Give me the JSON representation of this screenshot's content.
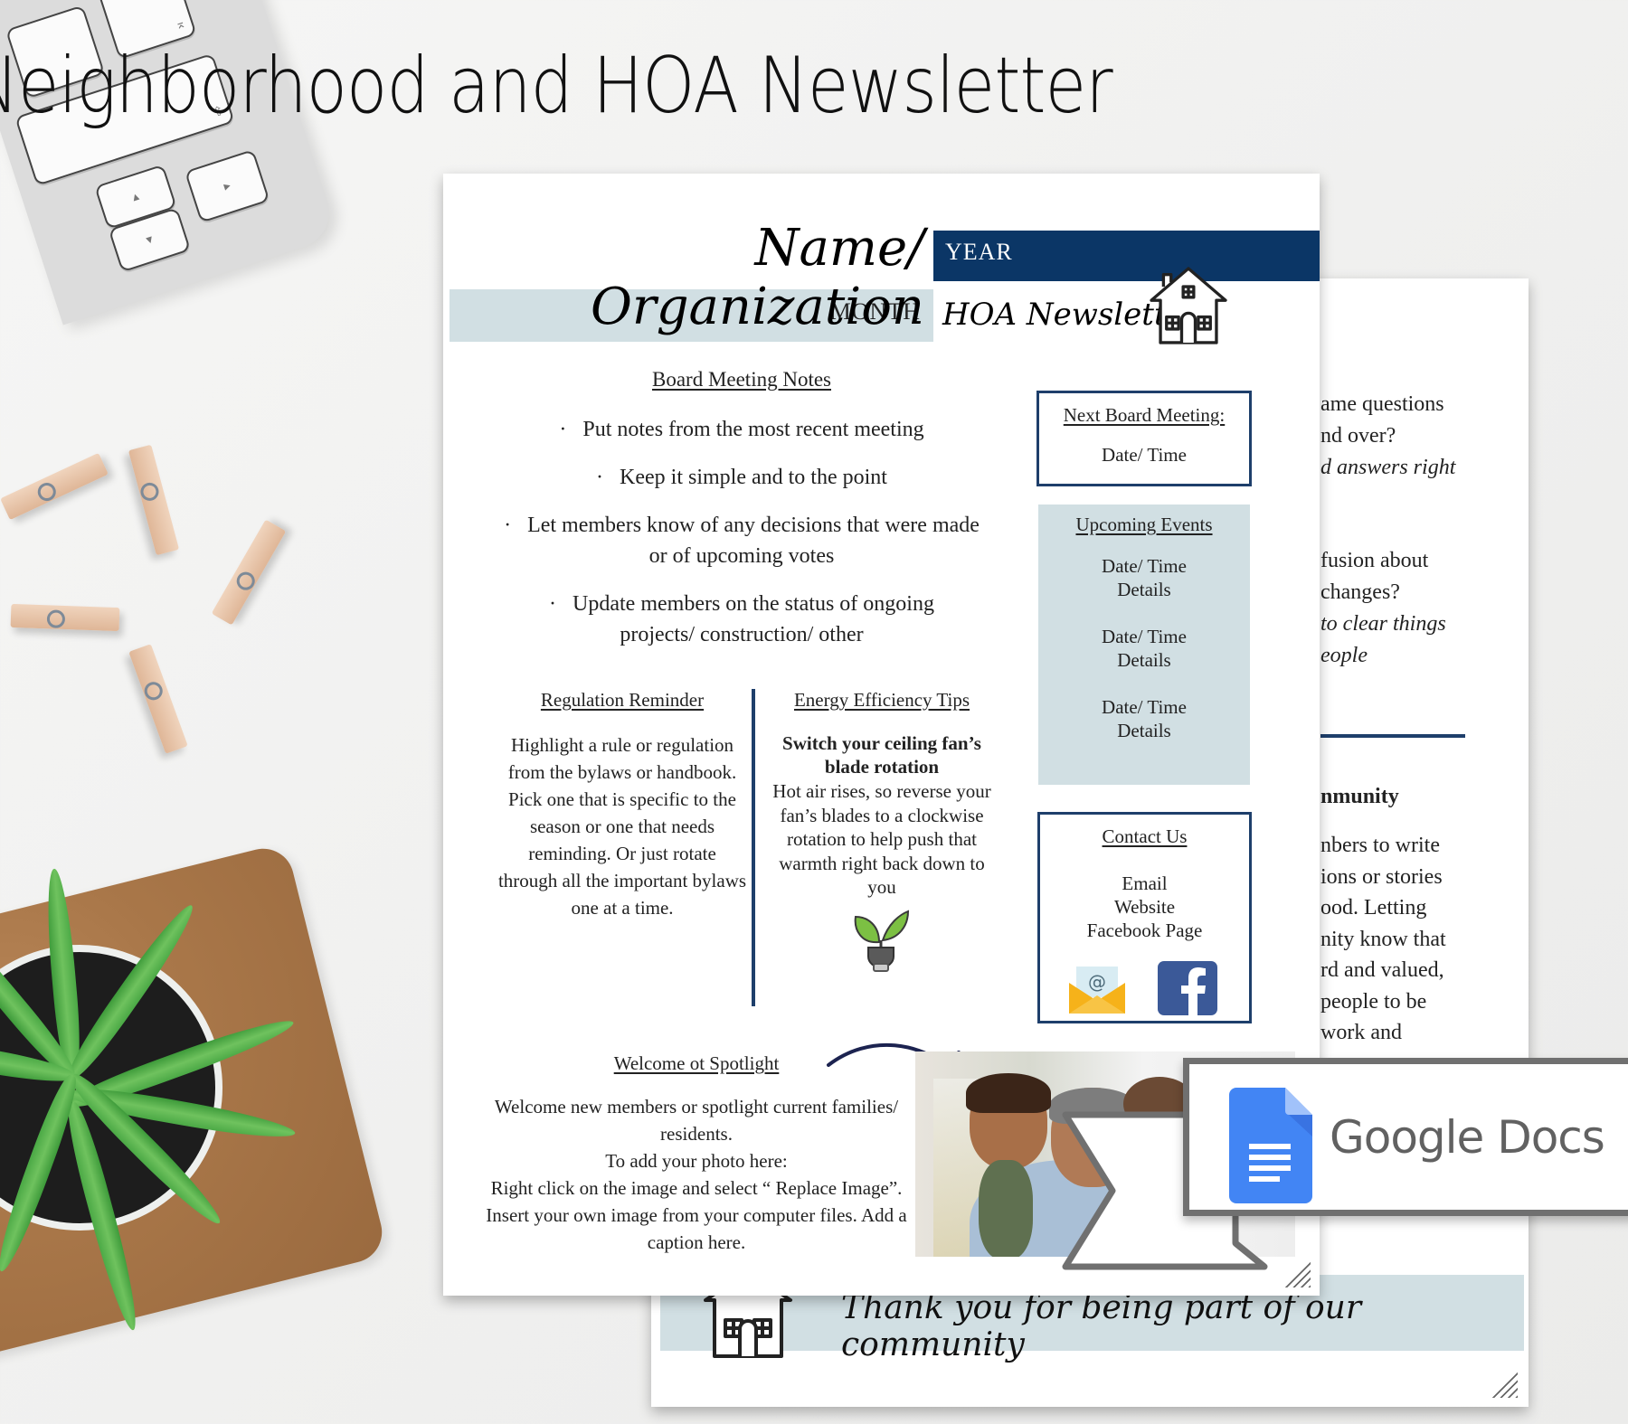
{
  "title": "Neighborhood and HOA Newsletter",
  "front_page": {
    "header": {
      "organization": "Name/ Organization",
      "year_label": "YEAR",
      "month_label": "MONTH",
      "newsletter_label": "HOA Newsletter"
    },
    "board_meeting_notes": {
      "heading": "Board Meeting Notes",
      "bullets": [
        "Put notes from the most recent meeting",
        "Keep it simple and to the point",
        "Let members know of any decisions that were made or of upcoming votes",
        "Update members on the status of ongoing projects/ construction/ other"
      ]
    },
    "next_board_meeting": {
      "heading": "Next Board Meeting:",
      "value": "Date/ Time"
    },
    "upcoming_events": {
      "heading": "Upcoming Events",
      "items": [
        {
          "date": "Date/ Time",
          "details": "Details"
        },
        {
          "date": "Date/ Time",
          "details": "Details"
        },
        {
          "date": "Date/ Time",
          "details": "Details"
        }
      ]
    },
    "regulation_reminder": {
      "heading": "Regulation Reminder",
      "text": "Highlight a rule or regulation from the bylaws or handbook. Pick one that is specific to the season or one that needs reminding. Or just rotate through all the important bylaws one at a time."
    },
    "energy_tips": {
      "heading": "Energy Efficiency Tips",
      "tip_title": "Switch your ceiling fan’s blade rotation",
      "tip_text": "Hot air rises, so reverse your fan’s blades to a clockwise rotation to help push that warmth right back down to you",
      "icon": "plant-bulb-icon"
    },
    "contact_us": {
      "heading": "Contact Us",
      "items": [
        "Email",
        "Website",
        "Facebook Page"
      ],
      "icons": [
        "email-icon",
        "facebook-icon"
      ]
    },
    "welcome_spotlight": {
      "heading": "Welcome ot Spotlight",
      "lines": [
        "Welcome new members or spotlight current families/ residents.",
        "To add your photo here:",
        "Right click on the image and select “ Replace Image”. Insert your own image from your computer files. Add a caption here."
      ]
    }
  },
  "back_page": {
    "partial_lines_1": [
      "ame questions",
      "nd over?",
      "d answers right"
    ],
    "partial_lines_2": [
      "fusion about",
      "changes?",
      "to clear things",
      "eople"
    ],
    "section_heading_partial": "nmunity",
    "partial_lines_3": [
      "nbers to write",
      "ions or stories",
      "ood. Letting",
      "nity know that",
      "rd and valued,",
      "people to be",
      "work and"
    ],
    "footer_text": "Thank you for being part of our community"
  },
  "badge": {
    "label": "Google Docs",
    "icon": "google-docs-icon"
  },
  "colors": {
    "navy": "#0b3666",
    "light_blue_band": "#d1dfe3",
    "google_blue": "#4285f4",
    "facebook_blue": "#3b5998"
  }
}
